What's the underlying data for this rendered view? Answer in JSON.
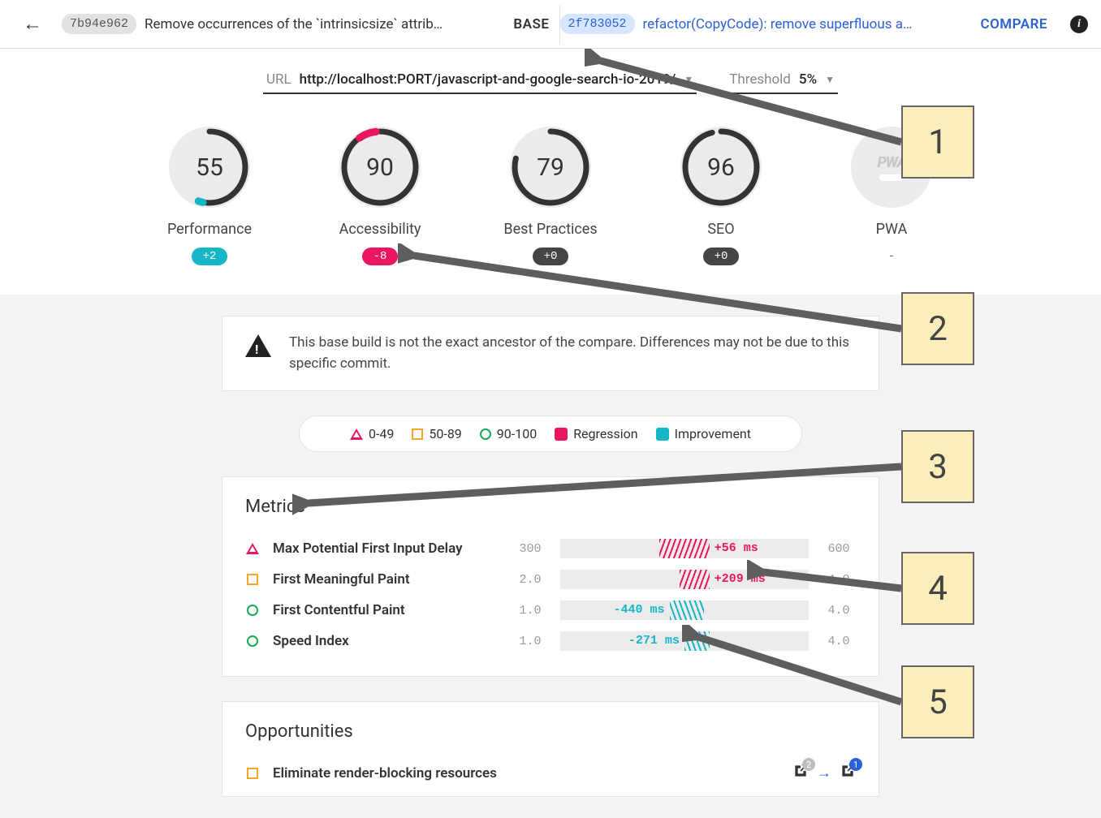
{
  "header": {
    "base": {
      "hash": "7b94e962",
      "message": "Remove occurrences of the `intrinsicsize` attrib…",
      "label": "BASE"
    },
    "compare": {
      "hash": "2f783052",
      "message": "refactor(CopyCode): remove superfluous a…",
      "label": "COMPARE"
    }
  },
  "controls": {
    "url_label": "URL",
    "url_value": "http://localhost:PORT/javascript-and-google-search-io-2019/",
    "threshold_label": "Threshold",
    "threshold_value": "5%"
  },
  "gauges": {
    "performance": {
      "title": "Performance",
      "score": "55",
      "delta": "+2"
    },
    "accessibility": {
      "title": "Accessibility",
      "score": "90",
      "delta": "-8"
    },
    "best_practices": {
      "title": "Best Practices",
      "score": "79",
      "delta": "+0"
    },
    "seo": {
      "title": "SEO",
      "score": "96",
      "delta": "+0"
    },
    "pwa": {
      "title": "PWA",
      "delta": "-"
    }
  },
  "warning": {
    "text": "This base build is not the exact ancestor of the compare. Differences may not be due to this specific commit."
  },
  "legend": {
    "r1": "0-49",
    "r2": "50-89",
    "r3": "90-100",
    "regression": "Regression",
    "improvement": "Improvement"
  },
  "metrics": {
    "title": "Metrics",
    "rows": [
      {
        "name": "Max Potential First Input Delay",
        "min": "300",
        "max": "600",
        "delta": "+56 ms",
        "dir": "reg",
        "shape": "tri",
        "pos": 40,
        "width": 20
      },
      {
        "name": "First Meaningful Paint",
        "min": "2.0",
        "max": "4.0",
        "delta": "+209 ms",
        "dir": "reg",
        "shape": "sq",
        "pos": 48,
        "width": 12
      },
      {
        "name": "First Contentful Paint",
        "min": "1.0",
        "max": "4.0",
        "delta": "-440 ms",
        "dir": "imp",
        "shape": "circ",
        "pos": 44,
        "width": 14
      },
      {
        "name": "Speed Index",
        "min": "1.0",
        "max": "4.0",
        "delta": "-271 ms",
        "dir": "imp",
        "shape": "circ",
        "pos": 50,
        "width": 10
      }
    ]
  },
  "opportunities": {
    "title": "Opportunities",
    "rows": [
      {
        "name": "Eliminate render-blocking resources",
        "base_badge": "2",
        "compare_badge": "1"
      }
    ]
  },
  "callouts": [
    "1",
    "2",
    "3",
    "4",
    "5"
  ]
}
